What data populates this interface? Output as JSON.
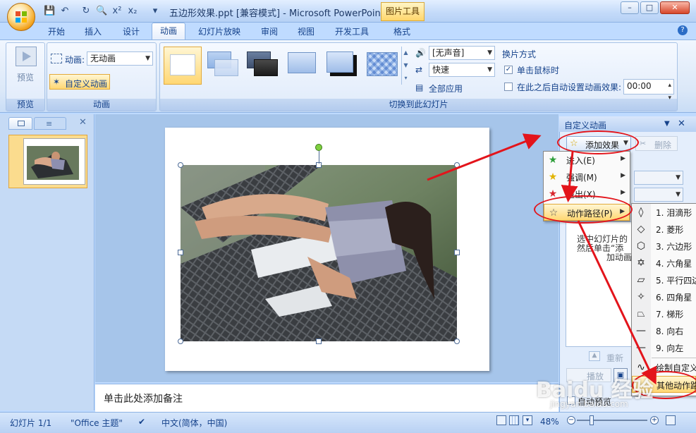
{
  "window": {
    "title": "五边形效果.ppt [兼容模式] - Microsoft PowerPoint",
    "context_tab": "图片工具"
  },
  "tabs": [
    "开始",
    "插入",
    "设计",
    "动画",
    "幻灯片放映",
    "审阅",
    "视图",
    "开发工具",
    "格式"
  ],
  "active_tab": "动画",
  "ribbon": {
    "preview": {
      "button_label": "预览",
      "group_label": "预览"
    },
    "animation": {
      "animation_label": "动画:",
      "animation_value": "无动画",
      "custom_animation_button": "自定义动画",
      "group_label": "动画"
    },
    "transition": {
      "sound_value": "[无声音]",
      "speed_value": "快速",
      "apply_all": "全部应用",
      "group_label": "切换到此幻灯片"
    },
    "advance": {
      "heading": "换片方式",
      "on_click_label": "单击鼠标时",
      "on_click_checked": true,
      "auto_after_label": "在此之后自动设置动画效果:",
      "auto_after_checked": false,
      "auto_after_time": "00:00"
    }
  },
  "slides_pane": {
    "slide_number": "1"
  },
  "notes_placeholder": "单击此处添加备注",
  "custom_animation_pane": {
    "title": "自定义动画",
    "add_effect_button": "添加效果",
    "remove_button": "删除",
    "hint_lines": [
      "选中幻灯片的",
      "然后单击“添",
      "加动画"
    ],
    "reorder_label": "重新",
    "play_label": "播放",
    "auto_preview_label": "自动预览"
  },
  "add_effect_menu": [
    {
      "label": "进入(E)",
      "icon": "entrance-star-icon"
    },
    {
      "label": "强调(M)",
      "icon": "emphasis-star-icon"
    },
    {
      "label": "退出(X)",
      "icon": "exit-star-icon"
    },
    {
      "label": "动作路径(P)",
      "icon": "motion-path-star-icon"
    }
  ],
  "motion_path_submenu": [
    {
      "label": "1. 泪滴形",
      "icon": "teardrop-path-icon"
    },
    {
      "label": "2. 菱形",
      "icon": "diamond-path-icon"
    },
    {
      "label": "3. 六边形",
      "icon": "hexagon-path-icon"
    },
    {
      "label": "4. 六角星",
      "icon": "six-point-star-path-icon"
    },
    {
      "label": "5. 平行四边",
      "icon": "parallelogram-path-icon"
    },
    {
      "label": "6. 四角星",
      "icon": "four-point-star-path-icon"
    },
    {
      "label": "7. 梯形",
      "icon": "trapezoid-path-icon"
    },
    {
      "label": "8. 向右",
      "icon": "right-line-path-icon"
    },
    {
      "label": "9. 向左",
      "icon": "left-line-path-icon"
    },
    {
      "label": "绘制自定义",
      "icon": "draw-custom-path-icon"
    },
    {
      "label": "其他动作路",
      "icon": "more-paths-icon"
    }
  ],
  "status_bar": {
    "slide_info": "幻灯片 1/1",
    "theme": "\"Office 主题\"",
    "language": "中文(简体，中国)",
    "zoom": "48%"
  },
  "watermark": {
    "main": "Baidu 经验",
    "sub": "jingyan.baidu.com"
  },
  "colors": {
    "annotation_red": "#e3141b",
    "selected_gold": "#ffd773",
    "ribbon_blue": "#bfdbff"
  }
}
